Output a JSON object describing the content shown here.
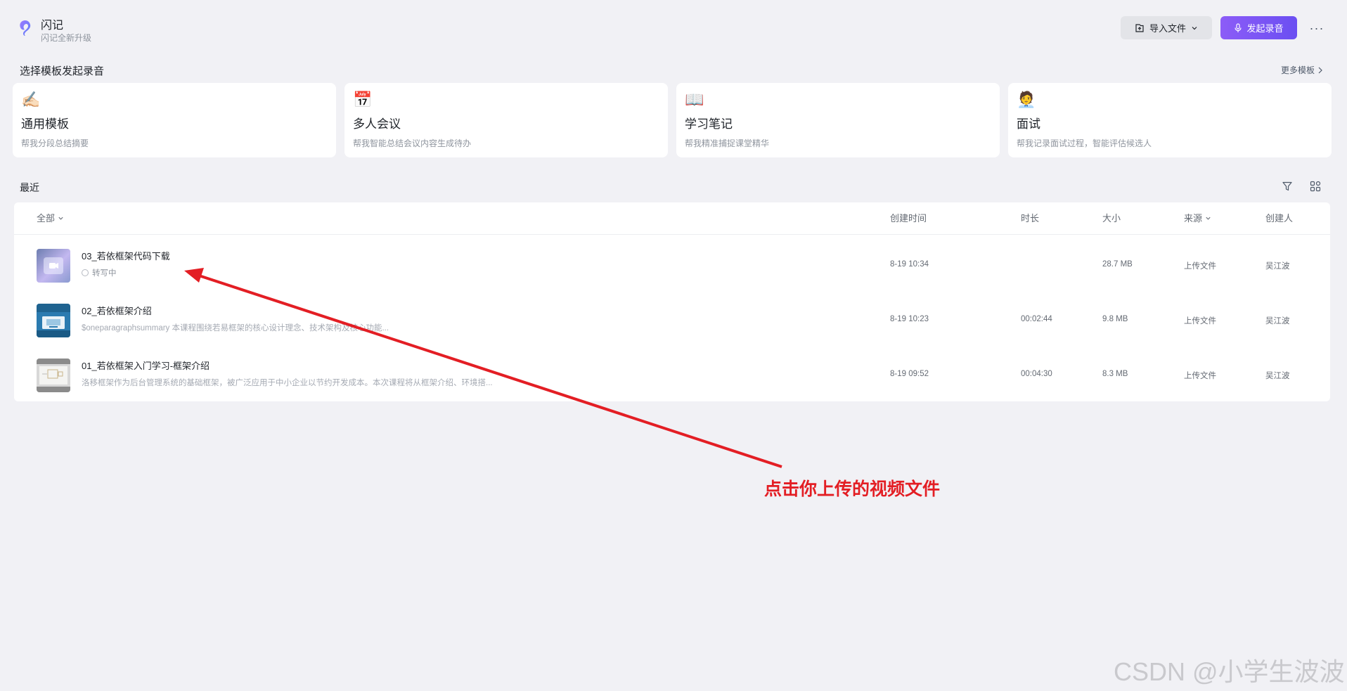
{
  "header": {
    "app_name": "闪记",
    "app_subtitle": "闪记全新升级",
    "import_label": "导入文件",
    "record_label": "发起录音",
    "more_label": "···"
  },
  "templates_section": {
    "title": "选择模板发起录音",
    "more_label": "更多模板",
    "cards": [
      {
        "emoji": "✍🏻",
        "title": "通用模板",
        "desc": "帮我分段总结摘要"
      },
      {
        "emoji": "📅",
        "title": "多人会议",
        "desc": "帮我智能总结会议内容生成待办"
      },
      {
        "emoji": "📖",
        "title": "学习笔记",
        "desc": "帮我精准捕捉课堂精华"
      },
      {
        "emoji": "🧑‍💼",
        "title": "面试",
        "desc": "帮我记录面试过程，智能评估候选人"
      }
    ]
  },
  "recent": {
    "title": "最近",
    "columns": {
      "all": "全部",
      "created": "创建时间",
      "duration": "时长",
      "size": "大小",
      "source": "来源",
      "creator": "创建人"
    },
    "rows": [
      {
        "name": "03_若依框架代码下载",
        "status": "转写中",
        "summary": "",
        "created": "8-19 10:34",
        "duration": "",
        "size": "28.7 MB",
        "source": "上传文件",
        "creator": "吴江波"
      },
      {
        "name": "02_若依框架介绍",
        "status": "",
        "summary": "$oneparagraphsummary 本课程围绕若易框架的核心设计理念、技术架构及核心功能...",
        "created": "8-19 10:23",
        "duration": "00:02:44",
        "size": "9.8 MB",
        "source": "上传文件",
        "creator": "吴江波"
      },
      {
        "name": "01_若依框架入门学习-框架介绍",
        "status": "",
        "summary": "洛移框架作为后台管理系统的基础框架，被广泛应用于中小企业以节约开发成本。本次课程将从框架介绍、环境搭...",
        "created": "8-19 09:52",
        "duration": "00:04:30",
        "size": "8.3 MB",
        "source": "上传文件",
        "creator": "吴江波"
      }
    ]
  },
  "annotation": {
    "text": "点击你上传的视频文件",
    "color": "#e31e24"
  },
  "watermark": "CSDN @小学生波波",
  "colors": {
    "accent": "#7552f5",
    "background": "#f1f1f5"
  }
}
